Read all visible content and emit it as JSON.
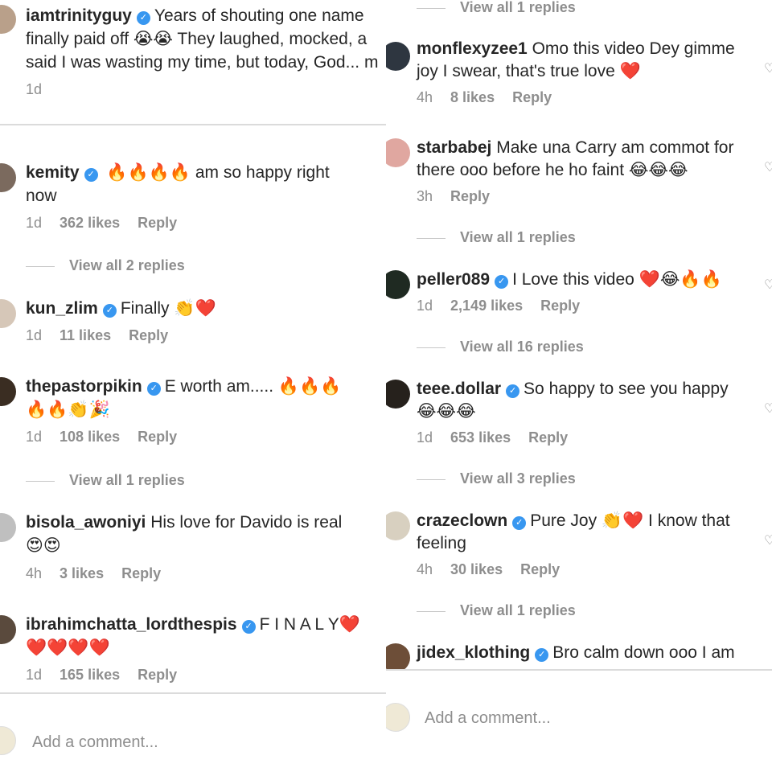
{
  "left": {
    "comments": [
      {
        "user": "iamtrinityguy",
        "verified": true,
        "text_lines": [
          "Years of shouting one name",
          "finally paid off 😭😭 They laughed, mocked, a",
          "said I was wasting my time, but today, God... m"
        ],
        "time": "1d",
        "likes": "",
        "reply": ""
      },
      {
        "user": "kemity",
        "verified": true,
        "text_lines": [
          "🔥🔥🔥🔥 am so happy right",
          "now"
        ],
        "time": "1d",
        "likes": "362 likes",
        "reply": "Reply",
        "view_replies": "View all 2 replies"
      },
      {
        "user": "kun_zlim",
        "verified": true,
        "text_lines": [
          "Finally 👏❤️"
        ],
        "time": "1d",
        "likes": "11 likes",
        "reply": "Reply"
      },
      {
        "user": "thepastorpikin",
        "verified": true,
        "text_lines": [
          "E worth am..... 🔥🔥🔥",
          "🔥🔥👏🎉"
        ],
        "time": "1d",
        "likes": "108 likes",
        "reply": "Reply",
        "view_replies": "View all 1 replies"
      },
      {
        "user": "bisola_awoniyi",
        "verified": false,
        "text_lines": [
          "His love for Davido is real",
          "😍😍"
        ],
        "time": "4h",
        "likes": "3 likes",
        "reply": "Reply"
      },
      {
        "user": "ibrahimchatta_lordthespis",
        "verified": true,
        "text_lines": [
          "F I N A L Y❤️",
          "❤️❤️❤️❤️"
        ],
        "time": "1d",
        "likes": "165 likes",
        "reply": "Reply"
      }
    ],
    "add_comment_placeholder": "Add a comment..."
  },
  "right": {
    "top_view_replies": "View all 1 replies",
    "comments": [
      {
        "user": "monflexyzee1",
        "verified": false,
        "text_lines": [
          "Omo this video Dey gimme",
          "joy I swear, that's true love ❤️"
        ],
        "time": "4h",
        "likes": "8 likes",
        "reply": "Reply"
      },
      {
        "user": "starbabej",
        "verified": false,
        "text_lines": [
          "Make una Carry am commot for",
          "there ooo before he ho faint 😂😂😂"
        ],
        "time": "3h",
        "likes": "",
        "reply": "Reply",
        "view_replies": "View all 1 replies"
      },
      {
        "user": "peller089",
        "verified": true,
        "text_lines": [
          "I Love this video ❤️😂🔥🔥"
        ],
        "time": "1d",
        "likes": "2,149 likes",
        "reply": "Reply",
        "view_replies": "View all 16 replies"
      },
      {
        "user": "teee.dollar",
        "verified": true,
        "text_lines": [
          "So happy to see you happy",
          "😂😂😂"
        ],
        "time": "1d",
        "likes": "653 likes",
        "reply": "Reply",
        "view_replies": "View all 3 replies"
      },
      {
        "user": "crazeclown",
        "verified": true,
        "text_lines": [
          "Pure Joy 👏❤️ I know that",
          "feeling"
        ],
        "time": "4h",
        "likes": "30 likes",
        "reply": "Reply",
        "view_replies": "View all 1 replies"
      },
      {
        "user": "jidex_klothing",
        "verified": true,
        "text_lines": [
          "Bro calm down ooo I am"
        ],
        "time": "",
        "likes": "",
        "reply": ""
      }
    ],
    "add_comment_placeholder": "Add a comment..."
  },
  "colors": {
    "verified": "#3897f0",
    "meta": "#8e8e8e",
    "heart": "#ed2a2a"
  }
}
